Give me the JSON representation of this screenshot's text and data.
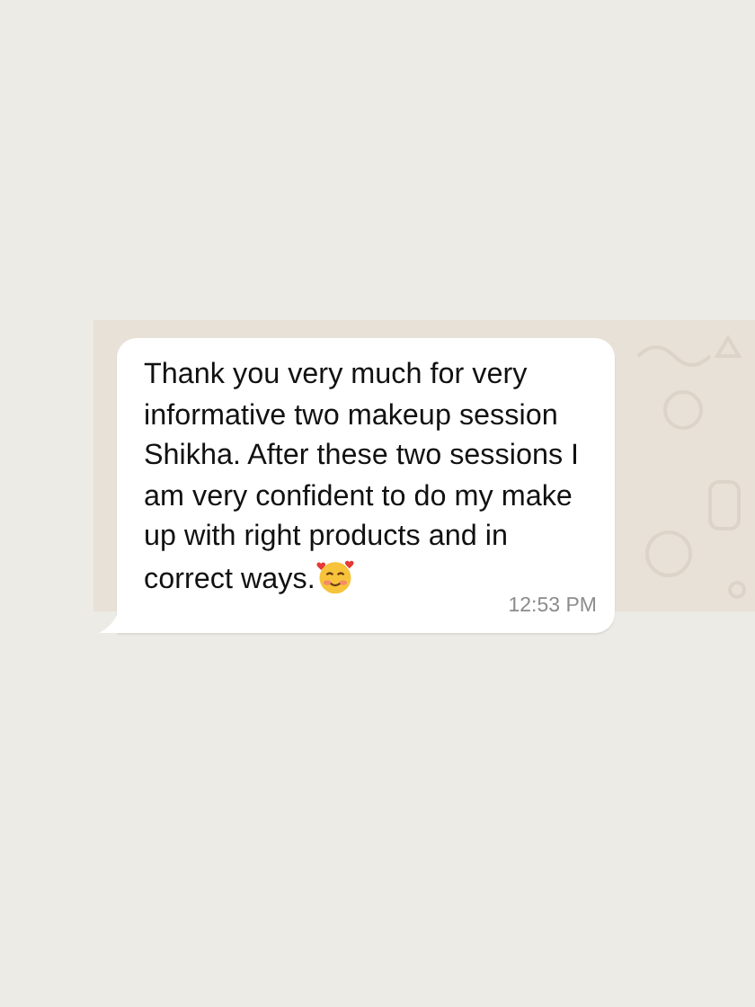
{
  "message": {
    "text": "Thank you very much for very informative two makeup session Shikha. After these two sessions I am very confident to do my make up with right products and in correct ways.",
    "time": "12:53 PM"
  }
}
